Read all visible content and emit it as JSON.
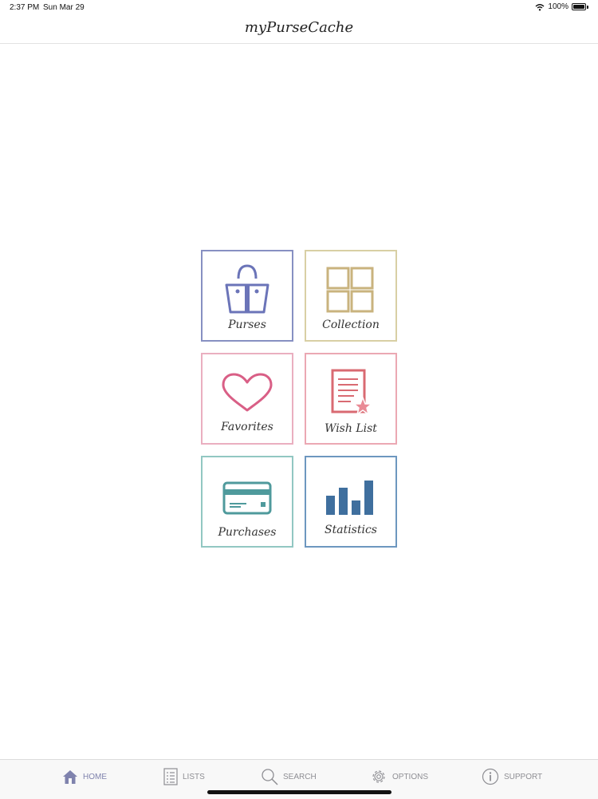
{
  "status": {
    "time": "2:37 PM",
    "date": "Sun Mar 29",
    "battery": "100%"
  },
  "nav": {
    "title": "myPurseCache"
  },
  "tiles": [
    {
      "label": "Purses",
      "icon": "handbag-icon",
      "color": "#6b74b8"
    },
    {
      "label": "Collection",
      "icon": "grid-icon",
      "color": "#c9b37e"
    },
    {
      "label": "Favorites",
      "icon": "heart-icon",
      "color": "#d95f86"
    },
    {
      "label": "Wish List",
      "icon": "document-star-icon",
      "color": "#d96a72"
    },
    {
      "label": "Purchases",
      "icon": "credit-card-icon",
      "color": "#4f9a9c"
    },
    {
      "label": "Statistics",
      "icon": "bar-chart-icon",
      "color": "#3f6f9e"
    }
  ],
  "tabs": [
    {
      "label": "HOME",
      "icon": "home-icon",
      "active": true
    },
    {
      "label": "LISTS",
      "icon": "list-icon"
    },
    {
      "label": "SEARCH",
      "icon": "search-icon"
    },
    {
      "label": "OPTIONS",
      "icon": "gear-icon"
    },
    {
      "label": "SUPPORT",
      "icon": "info-icon"
    }
  ],
  "colors": {
    "tab_active": "#7f82ad",
    "tab_inactive": "#8e8e93"
  }
}
